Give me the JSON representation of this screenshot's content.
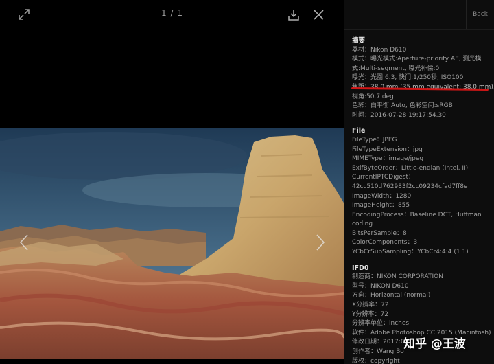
{
  "toolbar": {
    "counter": "1 / 1",
    "icons": [
      "expand-icon",
      "download-icon",
      "close-icon"
    ]
  },
  "sidebar": {
    "back_label": "Back",
    "summary": {
      "title": "摘要",
      "lines": [
        "器材：Nikon D610",
        "模式：曝光模式:Aperture-priority AE, 测光模",
        "式:Multi-segment, 曝光补偿:0",
        "曝光：光圈:6.3, 快门:1/250秒, ISO100",
        "焦距：38.0 mm (35 mm equivalent: 38.0 mm),",
        "视角:50.7 deg",
        "色彩：白平衡:Auto, 色彩空间:sRGB",
        "时间：2016-07-28 19:17:54.30"
      ]
    },
    "file": {
      "title": "File",
      "lines": [
        "FileType：JPEG",
        "FileTypeExtension：jpg",
        "MIMEType：image/jpeg",
        "ExifByteOrder：Little-endian (Intel, II)",
        "CurrentIPTCDigest：",
        "42cc510d762983f2cc09234cfad7ff8e",
        "ImageWidth：1280",
        "ImageHeight：855",
        "EncodingProcess：Baseline DCT, Huffman",
        "coding",
        "BitsPerSample：8",
        "ColorComponents：3",
        "YCbCrSubSampling：YCbCr4:4:4 (1 1)"
      ]
    },
    "ifd0": {
      "title": "IFD0",
      "lines": [
        "制造商：NIKON CORPORATION",
        "型号：NIKON D610",
        "方向：Horizontal (normal)",
        "X分辨率：72",
        "Y分辨率：72",
        "分辨率单位：inches",
        "软件：Adobe Photoshop CC 2015 (Macintosh)",
        "修改日期：2017:0",
        "创作者：Wang Bo",
        "版权：copyright"
      ]
    }
  },
  "watermark": {
    "text": "知乎 @王波"
  },
  "colors": {
    "highlight_underline": "#d01616",
    "panel_bg": "#0d0d0d"
  }
}
